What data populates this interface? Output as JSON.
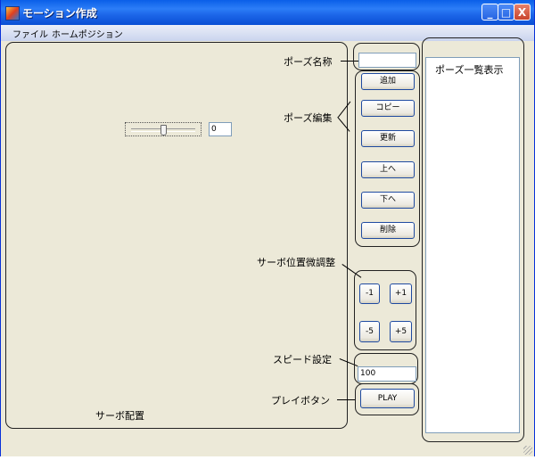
{
  "window": {
    "title": "モーション作成"
  },
  "title_buttons": {
    "minimize": "_",
    "maximize": "□",
    "close": "X"
  },
  "menu": [
    "ファイル",
    "ホームポジション"
  ],
  "servo_panel": {
    "label": "サーボ配置",
    "slider_value": 0.5,
    "value_box": "0"
  },
  "pose_name": {
    "label": "ポーズ名称",
    "value": ""
  },
  "pose_edit": {
    "label": "ポーズ編集",
    "buttons": [
      "追加",
      "コピー",
      "更新",
      "上へ",
      "下へ",
      "削除"
    ]
  },
  "servo_adjust": {
    "label": "サーボ位置微調整",
    "buttons": [
      "-1",
      "+1",
      "-5",
      "+5"
    ]
  },
  "speed": {
    "label": "スピード設定",
    "value": "100"
  },
  "play": {
    "label": "プレイボタン",
    "button": "PLAY"
  },
  "pose_list": {
    "header": "ポーズ一覧表示"
  }
}
